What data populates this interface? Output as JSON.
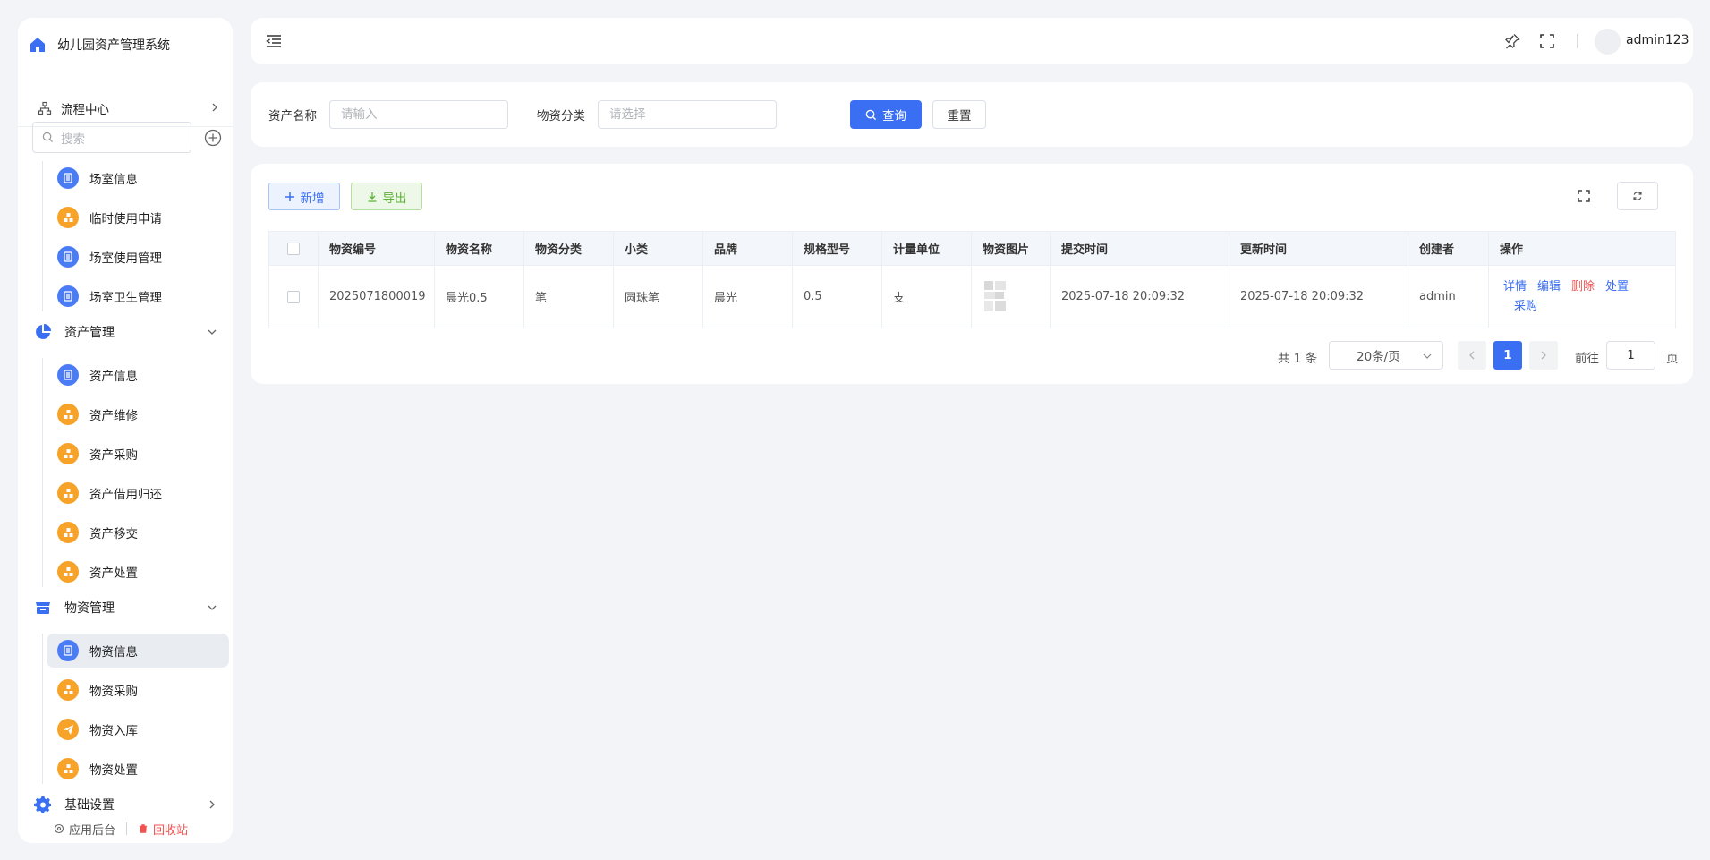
{
  "app": {
    "title": "幼儿园资产管理系统"
  },
  "sidebar": {
    "flow_center": "流程中心",
    "search_placeholder": "搜索",
    "space_items": [
      {
        "label": "场室信息",
        "icon": "document-icon",
        "color": "#4a7cf6"
      },
      {
        "label": "临时使用申请",
        "icon": "boxes-icon",
        "color": "#f7a229"
      },
      {
        "label": "场室使用管理",
        "icon": "document-icon",
        "color": "#4a7cf6"
      },
      {
        "label": "场室卫生管理",
        "icon": "document-icon",
        "color": "#4a7cf6"
      }
    ],
    "groups": [
      {
        "label": "资产管理",
        "icon": "pie-chart-icon",
        "items": [
          {
            "label": "资产信息",
            "icon": "document-icon",
            "color": "#4a7cf6"
          },
          {
            "label": "资产维修",
            "icon": "boxes-icon",
            "color": "#f7a229"
          },
          {
            "label": "资产采购",
            "icon": "boxes-icon",
            "color": "#f7a229"
          },
          {
            "label": "资产借用归还",
            "icon": "boxes-icon",
            "color": "#f7a229"
          },
          {
            "label": "资产移交",
            "icon": "boxes-icon",
            "color": "#f7a229"
          },
          {
            "label": "资产处置",
            "icon": "boxes-icon",
            "color": "#f7a229"
          }
        ]
      },
      {
        "label": "物资管理",
        "icon": "store-icon",
        "items": [
          {
            "label": "物资信息",
            "icon": "document-icon",
            "color": "#4a7cf6",
            "active": true
          },
          {
            "label": "物资采购",
            "icon": "boxes-icon",
            "color": "#f7a229"
          },
          {
            "label": "物资入库",
            "icon": "send-icon",
            "color": "#f7a229"
          },
          {
            "label": "物资处置",
            "icon": "boxes-icon",
            "color": "#f7a229"
          }
        ]
      },
      {
        "label": "基础设置",
        "icon": "gear-icon",
        "items": []
      }
    ],
    "footer": {
      "app_backend": "应用后台",
      "recycle_bin": "回收站"
    }
  },
  "header": {
    "username": "admin123"
  },
  "search": {
    "asset_name_label": "资产名称",
    "asset_name_placeholder": "请输入",
    "category_label": "物资分类",
    "category_placeholder": "请选择",
    "query_btn": "查询",
    "reset_btn": "重置"
  },
  "toolbar": {
    "add_btn": "新增",
    "export_btn": "导出"
  },
  "table": {
    "columns": [
      "物资编号",
      "物资名称",
      "物资分类",
      "小类",
      "品牌",
      "规格型号",
      "计量单位",
      "物资图片",
      "提交时间",
      "更新时间",
      "创建者",
      "操作"
    ],
    "rows": [
      {
        "code": "2025071800019",
        "name": "晨光0.5",
        "category": "笔",
        "subcategory": "圆珠笔",
        "brand": "晨光",
        "spec": "0.5",
        "unit": "支",
        "submit_time": "2025-07-18 20:09:32",
        "update_time": "2025-07-18 20:09:32",
        "creator": "admin",
        "actions": {
          "detail": "详情",
          "edit": "编辑",
          "delete": "删除",
          "dispose": "处置",
          "purchase": "采购"
        }
      }
    ]
  },
  "pagination": {
    "total_text": "共 1 条",
    "page_size": "20条/页",
    "current_page": "1",
    "goto_label": "前往",
    "goto_value": "1",
    "page_suffix": "页"
  },
  "colors": {
    "primary": "#3a6ff3",
    "danger": "#f05252",
    "success": "#5cb336",
    "warning": "#f7a229"
  }
}
